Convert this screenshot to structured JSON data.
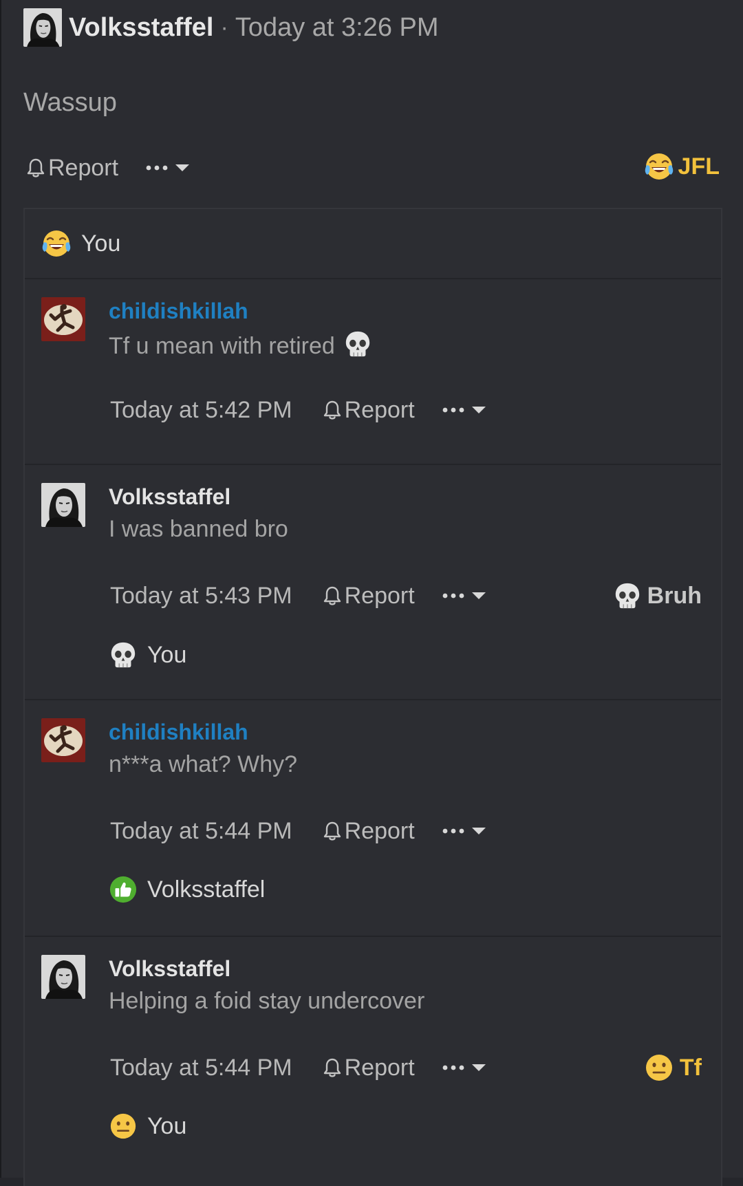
{
  "post": {
    "author": "Volksstaffel",
    "separator": "·",
    "time": "Today at 3:26 PM",
    "body": "Wassup",
    "report_label": "Report",
    "reaction": {
      "label": "JFL",
      "icon": "laughing-crying-emoji",
      "color": "#f2c13c"
    }
  },
  "reactors": [
    {
      "icon": "laughing-crying-emoji",
      "name": "You"
    }
  ],
  "comments": [
    {
      "author": "childishkillah",
      "author_color": "#1f80c2",
      "body": "Tf u mean with retired",
      "body_emoji": "skull-emoji",
      "time": "Today at 5:42 PM",
      "report_label": "Report"
    },
    {
      "author": "Volksstaffel",
      "author_color": "#e4e4e4",
      "body": "I was banned bro",
      "time": "Today at 5:43 PM",
      "report_label": "Report",
      "reaction": {
        "label": "Bruh",
        "icon": "skull-emoji",
        "color": "#c9c9c9"
      },
      "reactor": {
        "icon": "skull-emoji",
        "name": "You"
      }
    },
    {
      "author": "childishkillah",
      "author_color": "#1f80c2",
      "body": "n***a what? Why?",
      "time": "Today at 5:44 PM",
      "report_label": "Report",
      "reactor": {
        "icon": "thumbs-up-icon",
        "name": "Volksstaffel"
      }
    },
    {
      "author": "Volksstaffel",
      "author_color": "#e4e4e4",
      "body": "Helping a foid stay undercover",
      "time": "Today at 5:44 PM",
      "report_label": "Report",
      "reaction": {
        "label": "Tf",
        "icon": "neutral-face-emoji",
        "color": "#f2c13c"
      },
      "reactor": {
        "icon": "neutral-face-emoji",
        "name": "You"
      }
    }
  ]
}
